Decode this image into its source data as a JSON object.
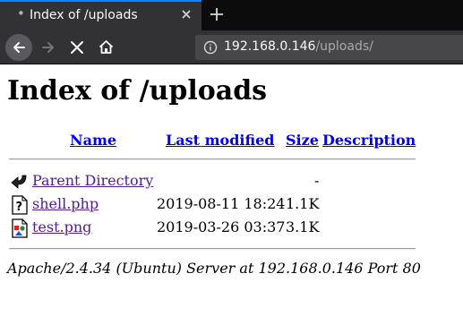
{
  "browser": {
    "tab": {
      "title": "Index of /uploads"
    },
    "url": {
      "host": "192.168.0.146",
      "path": "/uploads/"
    }
  },
  "page": {
    "title": "Index of /uploads",
    "columns": {
      "name": "Name",
      "last_modified": "Last modified",
      "size": "Size",
      "description": "Description"
    },
    "entries": [
      {
        "name": "Parent Directory",
        "date": "",
        "size": "-",
        "icon": "back-icon"
      },
      {
        "name": "shell.php",
        "date": "2019-08-11 18:24",
        "size": "1.1K",
        "icon": "unknown-file-icon"
      },
      {
        "name": "test.png",
        "date": "2019-03-26 03:37",
        "size": "3.1K",
        "icon": "image-file-icon"
      }
    ],
    "address": "Apache/2.4.34 (Ubuntu) Server at 192.168.0.146 Port 80"
  }
}
